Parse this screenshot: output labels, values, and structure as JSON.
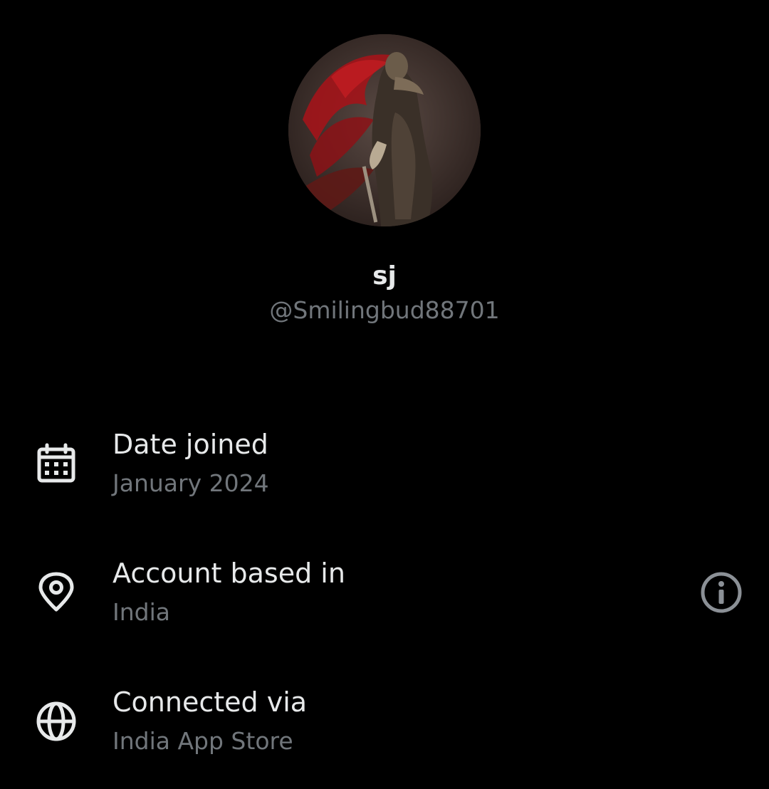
{
  "profile": {
    "display_name": "sj",
    "handle": "@Smilingbud88701",
    "avatar_icon": "avatar-image"
  },
  "details": [
    {
      "icon": "calendar-icon",
      "label": "Date joined",
      "value": "January 2024"
    },
    {
      "icon": "location-pin-icon",
      "label": "Account based in",
      "value": "India",
      "info_icon": "info-icon"
    },
    {
      "icon": "globe-icon",
      "label": "Connected via",
      "value": "India App Store"
    }
  ],
  "colors": {
    "background": "#000000",
    "primary_text": "#e7e9ea",
    "secondary_text": "#71767b",
    "info_icon": "#8b9096"
  }
}
